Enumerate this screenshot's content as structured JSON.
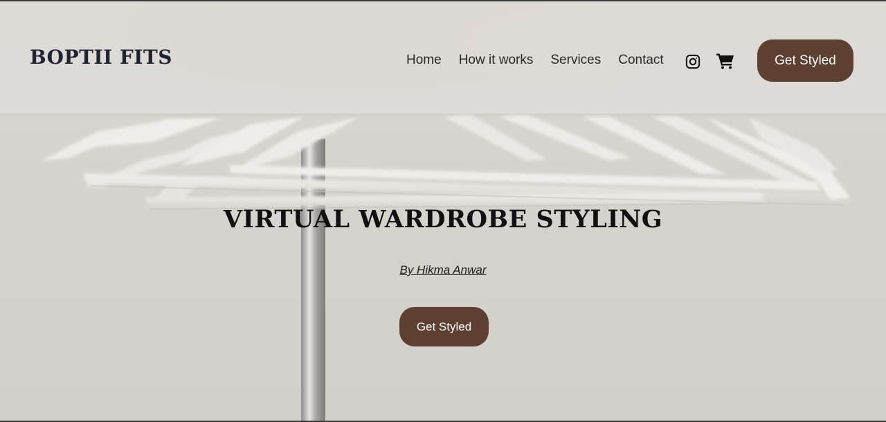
{
  "header": {
    "logo": "BOPTII FITS",
    "nav": [
      {
        "label": "Home"
      },
      {
        "label": "How it works"
      },
      {
        "label": "Services"
      },
      {
        "label": "Contact"
      }
    ],
    "icons": [
      "instagram-icon",
      "cart-icon"
    ],
    "cta_label": "Get Styled"
  },
  "hero": {
    "title": "VIRTUAL WARDROBE STYLING",
    "byline": "By Hikma Anwar",
    "cta_label": "Get Styled"
  },
  "colors": {
    "accent": "#5d4031",
    "background": "#d7d4cf",
    "text": "#1f2430"
  }
}
